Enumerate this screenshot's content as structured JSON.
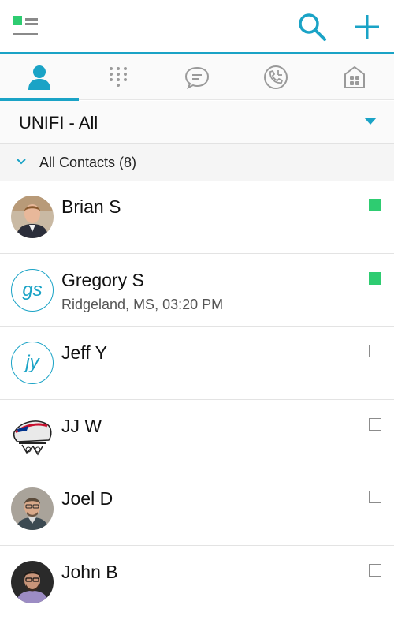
{
  "theme": {
    "accent": "#1aa3c6",
    "online": "#2ecc71"
  },
  "header": {
    "menu_icon": "menu-icon",
    "search_icon": "search-icon",
    "add_icon": "plus-icon"
  },
  "tabs": [
    {
      "icon": "person-icon",
      "active": true
    },
    {
      "icon": "dialpad-icon",
      "active": false
    },
    {
      "icon": "chat-icon",
      "active": false
    },
    {
      "icon": "call-history-icon",
      "active": false
    },
    {
      "icon": "apps-icon",
      "active": false
    }
  ],
  "filter": {
    "label": "UNIFI -  All"
  },
  "group": {
    "label": "All Contacts (8)"
  },
  "contacts": [
    {
      "name": "Brian S",
      "subtitle": "",
      "avatar": "photo",
      "status": "online"
    },
    {
      "name": "Gregory S",
      "subtitle": "Ridgeland, MS, 03:20 PM",
      "avatar": "gs",
      "status": "online"
    },
    {
      "name": "Jeff Y",
      "subtitle": "",
      "avatar": "jy",
      "status": "offline"
    },
    {
      "name": "JJ W",
      "subtitle": "",
      "avatar": "logo",
      "status": "offline"
    },
    {
      "name": "Joel D",
      "subtitle": "",
      "avatar": "photo",
      "status": "offline"
    },
    {
      "name": "John B",
      "subtitle": "",
      "avatar": "photo",
      "status": "offline"
    }
  ]
}
